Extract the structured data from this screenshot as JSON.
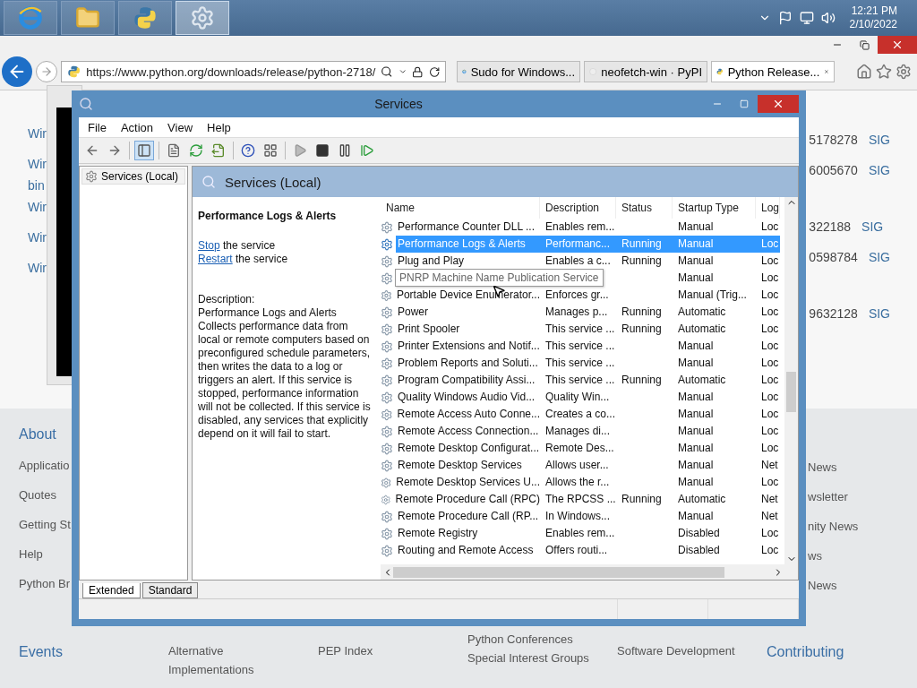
{
  "taskbar": {
    "apps": [
      {
        "kind": "browser",
        "selected": false
      },
      {
        "kind": "folder",
        "selected": false
      },
      {
        "kind": "python",
        "selected": false
      },
      {
        "kind": "gear",
        "selected": true
      }
    ],
    "clock": {
      "time": "12:21 PM",
      "date": "2/10/2022"
    }
  },
  "browser": {
    "url": "https://www.python.org/downloads/release/python-2718/",
    "tabs": [
      {
        "title": "Sudo for Windows...",
        "kind": "browser",
        "selected": false
      },
      {
        "title": "neofetch-win · PyPI",
        "kind": "blank",
        "selected": false
      },
      {
        "title": "Python Release...",
        "kind": "python",
        "selected": true
      }
    ]
  },
  "page": {
    "downloads": [
      {
        "name": "Wir",
        "size": "5178278",
        "sig": "SIG"
      },
      {
        "name": "Wir",
        "name_line2": "bin",
        "size": "6005670",
        "sig": "SIG"
      },
      {
        "name": "Wir",
        "size": "322188",
        "sig": "SIG"
      },
      {
        "name": "Wir",
        "size": "0598784",
        "sig": "SIG"
      },
      {
        "name": "Wir",
        "size": "9632128",
        "sig": "SIG"
      }
    ],
    "footer": {
      "about": {
        "heading": "About",
        "links": [
          "Applicatio",
          "Quotes",
          "Getting St",
          "Help",
          "Python Br"
        ]
      },
      "right_links": [
        "News",
        "wsletter",
        "nity News",
        "ws",
        "News"
      ],
      "bottom": [
        {
          "heading": "Events"
        },
        {
          "links": [
            "Alternative",
            "Implementations"
          ]
        },
        {
          "links": [
            "PEP Index"
          ]
        },
        {
          "links": [
            "Python Conferences",
            "Special Interest Groups"
          ]
        },
        {
          "links": [
            "Software Development"
          ]
        },
        {
          "heading": "Contributing"
        }
      ]
    }
  },
  "services": {
    "title": "Services",
    "menu": [
      "File",
      "Action",
      "View",
      "Help"
    ],
    "toolbar": [
      {
        "kind": "back"
      },
      {
        "kind": "forward"
      },
      {
        "kind": "sep"
      },
      {
        "kind": "tree",
        "selected": true
      },
      {
        "kind": "sep"
      },
      {
        "kind": "properties"
      },
      {
        "kind": "refresh"
      },
      {
        "kind": "export"
      },
      {
        "kind": "sep"
      },
      {
        "kind": "help"
      },
      {
        "kind": "view"
      },
      {
        "kind": "sep"
      },
      {
        "kind": "play"
      },
      {
        "kind": "stop"
      },
      {
        "kind": "pause"
      },
      {
        "kind": "resume"
      }
    ],
    "tree": [
      {
        "label": "Services (Local)",
        "selected": true
      }
    ],
    "pane_title": "Services (Local)",
    "detail": {
      "name": "Performance Logs & Alerts",
      "actions": [
        {
          "link": "Stop",
          "text": "the service"
        },
        {
          "link": "Restart",
          "text": "the service"
        }
      ],
      "description_label": "Description:",
      "description": "Performance Logs and Alerts Collects performance data from local or remote computers based on preconfigured schedule parameters, then writes the data to a log or triggers an alert. If this service is stopped, performance information will not be collected. If this service is disabled, any services that explicitly depend on it will fail to start."
    },
    "columns": [
      "Name",
      "Description",
      "Status",
      "Startup Type",
      "Log"
    ],
    "rows": [
      {
        "name": "Performance Counter DLL ...",
        "description": "Enables rem...",
        "startup": "Manual",
        "log": "Loc",
        "selected": false
      },
      {
        "name": "Performance Logs & Alerts",
        "description": "Performanc...",
        "status": "Running",
        "startup": "Manual",
        "log": "Loc",
        "selected": true
      },
      {
        "name": "Plug and Play",
        "description": "Enables a c...",
        "status": "Running",
        "startup": "Manual",
        "log": "Loc",
        "selected": false
      },
      {
        "startup": "Manual",
        "log": "Loc",
        "selected": false
      },
      {
        "name": "Portable Device Enumerator...",
        "description": "Enforces gr...",
        "startup": "Manual (Trig...",
        "log": "Loc",
        "selected": false
      },
      {
        "name": "Power",
        "description": "Manages p...",
        "status": "Running",
        "startup": "Automatic",
        "log": "Loc",
        "selected": false
      },
      {
        "name": "Print Spooler",
        "description": "This service ...",
        "status": "Running",
        "startup": "Automatic",
        "log": "Loc",
        "selected": false
      },
      {
        "name": "Printer Extensions and Notif...",
        "description": "This service ...",
        "startup": "Manual",
        "log": "Loc",
        "selected": false
      },
      {
        "name": "Problem Reports and Soluti...",
        "description": "This service ...",
        "startup": "Manual",
        "log": "Loc",
        "selected": false
      },
      {
        "name": "Program Compatibility Assi...",
        "description": "This service ...",
        "status": "Running",
        "startup": "Automatic",
        "log": "Loc",
        "selected": false
      },
      {
        "name": "Quality Windows Audio Vid...",
        "description": "Quality Win...",
        "startup": "Manual",
        "log": "Loc",
        "selected": false
      },
      {
        "name": "Remote Access Auto Conne...",
        "description": "Creates a co...",
        "startup": "Manual",
        "log": "Loc",
        "selected": false
      },
      {
        "name": "Remote Access Connection...",
        "description": "Manages di...",
        "startup": "Manual",
        "log": "Loc",
        "selected": false
      },
      {
        "name": "Remote Desktop Configurat...",
        "description": "Remote Des...",
        "startup": "Manual",
        "log": "Loc",
        "selected": false
      },
      {
        "name": "Remote Desktop Services",
        "description": "Allows user...",
        "startup": "Manual",
        "log": "Net",
        "selected": false
      },
      {
        "name": "Remote Desktop Services U...",
        "description": "Allows the r...",
        "startup": "Manual",
        "log": "Loc",
        "selected": false
      },
      {
        "name": "Remote Procedure Call (RPC)",
        "description": "The RPCSS ...",
        "status": "Running",
        "startup": "Automatic",
        "log": "Net",
        "selected": false
      },
      {
        "name": "Remote Procedure Call (RP...",
        "description": "In Windows...",
        "startup": "Manual",
        "log": "Net",
        "selected": false
      },
      {
        "name": "Remote Registry",
        "description": "Enables rem...",
        "startup": "Disabled",
        "log": "Loc",
        "selected": false
      },
      {
        "name": "Routing and Remote Access",
        "description": "Offers routi...",
        "startup": "Disabled",
        "log": "Loc",
        "selected": false
      }
    ],
    "tooltip": "PNRP Machine Name Publication Service",
    "view_tabs": [
      {
        "label": "Extended",
        "selected": true
      },
      {
        "label": "Standard",
        "selected": false
      }
    ]
  }
}
